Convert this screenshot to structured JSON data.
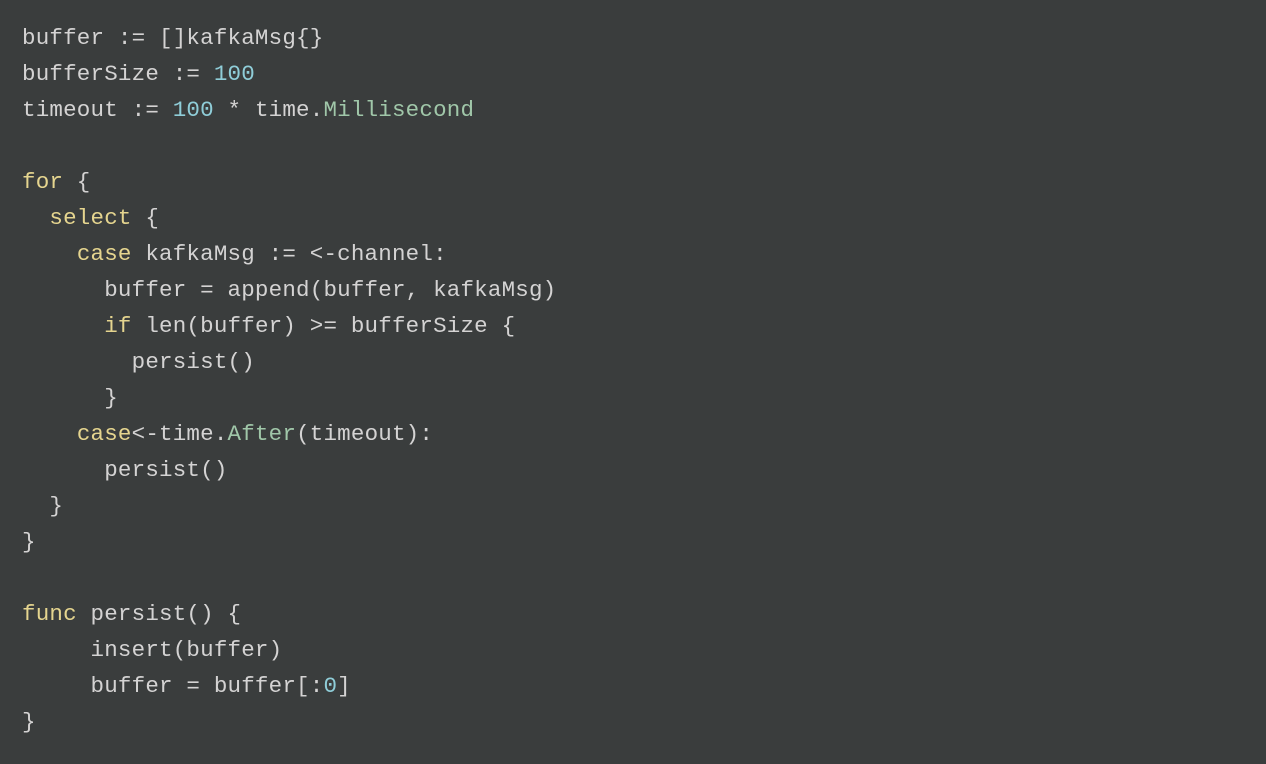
{
  "code": {
    "lines": [
      [
        {
          "t": "buffer := []kafkaMsg{}",
          "cls": "c-default"
        }
      ],
      [
        {
          "t": "bufferSize := ",
          "cls": "c-default"
        },
        {
          "t": "100",
          "cls": "c-number"
        }
      ],
      [
        {
          "t": "timeout := ",
          "cls": "c-default"
        },
        {
          "t": "100",
          "cls": "c-number"
        },
        {
          "t": " * time.",
          "cls": "c-default"
        },
        {
          "t": "Millisecond",
          "cls": "c-call"
        }
      ],
      [
        {
          "t": "",
          "cls": "c-default"
        }
      ],
      [
        {
          "t": "for",
          "cls": "c-keyword"
        },
        {
          "t": " {",
          "cls": "c-default"
        }
      ],
      [
        {
          "t": "  ",
          "cls": "c-default"
        },
        {
          "t": "select",
          "cls": "c-keyword"
        },
        {
          "t": " {",
          "cls": "c-default"
        }
      ],
      [
        {
          "t": "    ",
          "cls": "c-default"
        },
        {
          "t": "case",
          "cls": "c-keyword"
        },
        {
          "t": " kafkaMsg := <-channel:",
          "cls": "c-default"
        }
      ],
      [
        {
          "t": "      buffer = append(buffer, kafkaMsg)",
          "cls": "c-default"
        }
      ],
      [
        {
          "t": "      ",
          "cls": "c-default"
        },
        {
          "t": "if",
          "cls": "c-keyword"
        },
        {
          "t": " len(buffer) >= bufferSize {",
          "cls": "c-default"
        }
      ],
      [
        {
          "t": "        persist()",
          "cls": "c-default"
        }
      ],
      [
        {
          "t": "      }",
          "cls": "c-default"
        }
      ],
      [
        {
          "t": "    ",
          "cls": "c-default"
        },
        {
          "t": "case",
          "cls": "c-keyword"
        },
        {
          "t": "<-time.",
          "cls": "c-default"
        },
        {
          "t": "After",
          "cls": "c-call"
        },
        {
          "t": "(timeout):",
          "cls": "c-default"
        }
      ],
      [
        {
          "t": "      persist()",
          "cls": "c-default"
        }
      ],
      [
        {
          "t": "  }",
          "cls": "c-default"
        }
      ],
      [
        {
          "t": "}",
          "cls": "c-default"
        }
      ],
      [
        {
          "t": "",
          "cls": "c-default"
        }
      ],
      [
        {
          "t": "func",
          "cls": "c-keyword"
        },
        {
          "t": " persist() {",
          "cls": "c-default"
        }
      ],
      [
        {
          "t": "     insert(buffer)",
          "cls": "c-default"
        }
      ],
      [
        {
          "t": "     buffer = buffer[:",
          "cls": "c-default"
        },
        {
          "t": "0",
          "cls": "c-number"
        },
        {
          "t": "]",
          "cls": "c-default"
        }
      ],
      [
        {
          "t": "}",
          "cls": "c-default"
        }
      ]
    ]
  }
}
